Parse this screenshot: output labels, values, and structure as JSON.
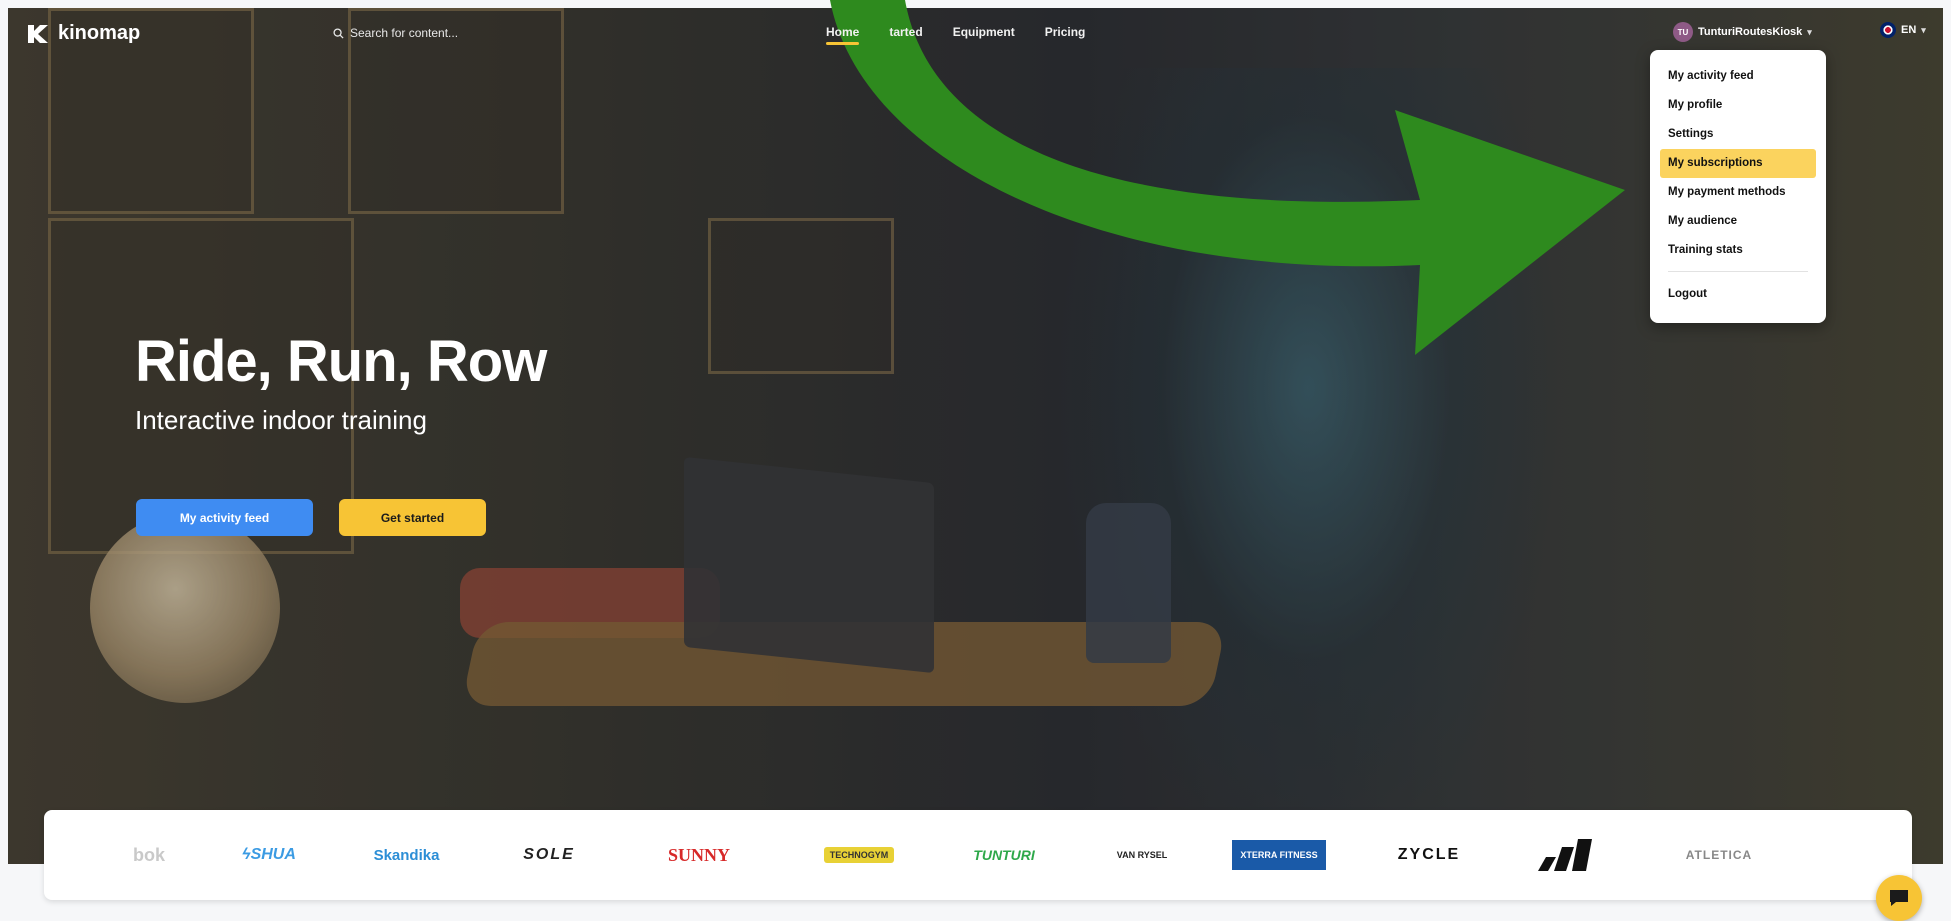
{
  "header": {
    "logo_text": "kinomap",
    "search_placeholder": "Search for content...",
    "nav": [
      {
        "label": "Home",
        "active": true
      },
      {
        "label": "Get started",
        "visible_text": "tarted"
      },
      {
        "label": "Equipment"
      },
      {
        "label": "Pricing"
      }
    ],
    "user": {
      "initials": "TU",
      "name": "TunturiRoutesKiosk"
    },
    "language": "EN"
  },
  "user_menu": {
    "items": [
      {
        "label": "My activity feed"
      },
      {
        "label": "My profile"
      },
      {
        "label": "Settings"
      },
      {
        "label": "My subscriptions",
        "highlighted": true
      },
      {
        "label": "My payment methods"
      },
      {
        "label": "My audience"
      },
      {
        "label": "Training stats"
      }
    ],
    "logout": "Logout"
  },
  "hero": {
    "headline": "Ride, Run, Row",
    "subtitle": "Interactive indoor training",
    "primary_button": "My activity feed",
    "secondary_button": "Get started"
  },
  "brands": [
    "bok",
    "SHUA",
    "Skandika",
    "SOLE",
    "SUNNY",
    "TECHNOGYM",
    "TUNTURI",
    "VAN RYSEL",
    "XTERRA FITNESS",
    "ZYCLE",
    "adidas",
    "ATLETICA"
  ],
  "colors": {
    "accent_yellow": "#f7c435",
    "primary_blue": "#3f8cf2",
    "annotation_arrow": "#2e8a1e",
    "menu_highlight": "#fbd35e"
  },
  "icons": {
    "logo": "kinomap-logo-icon",
    "search": "search-icon",
    "chat": "chat-bubble-icon",
    "flag": "uk-flag-icon"
  }
}
